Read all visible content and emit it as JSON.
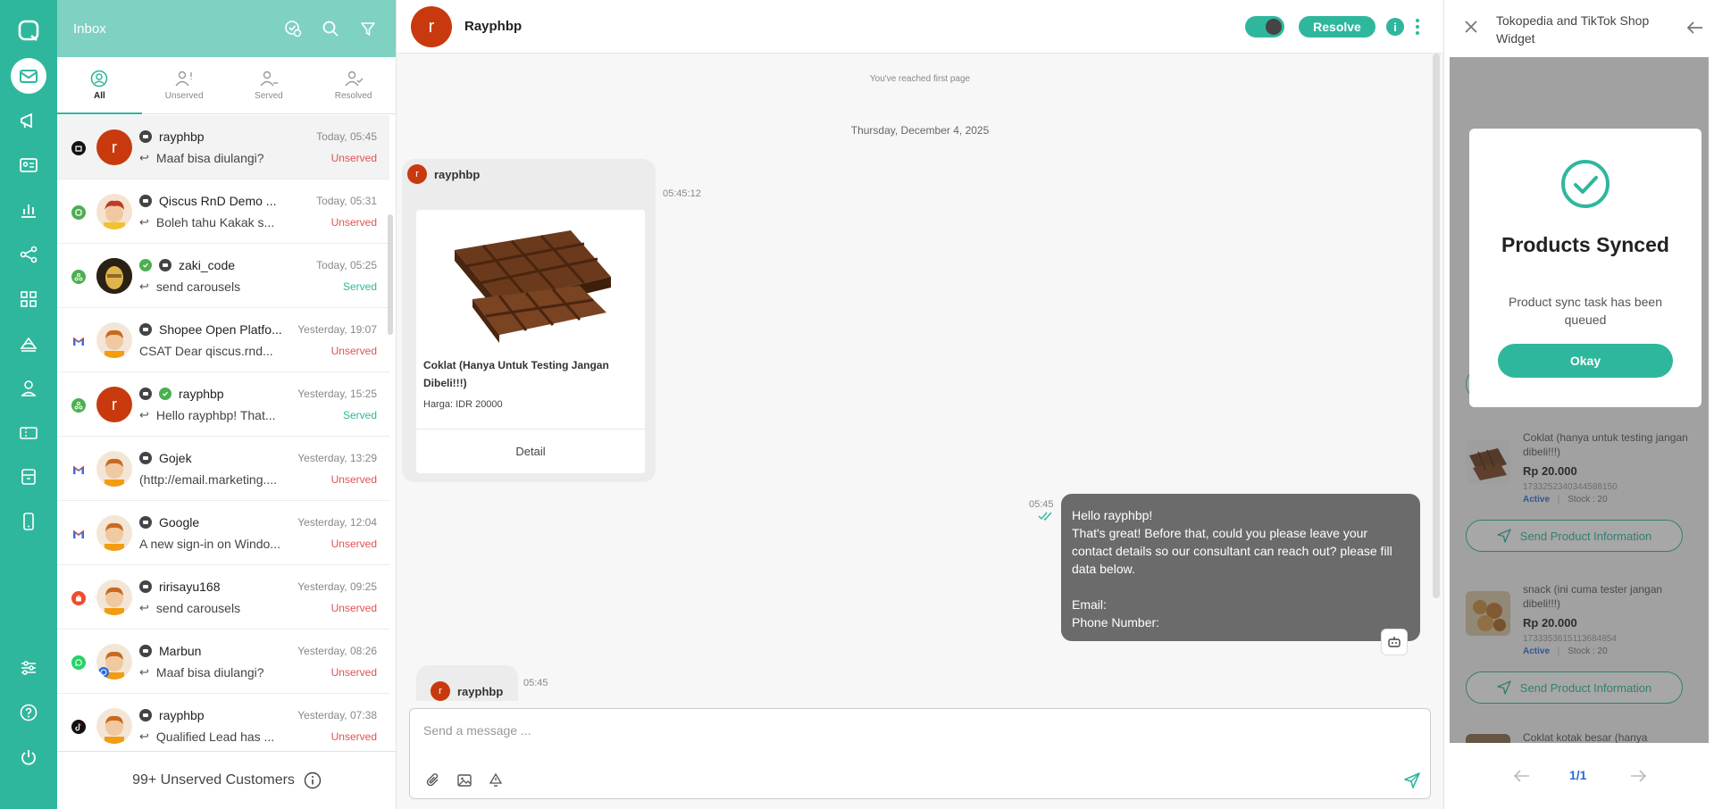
{
  "inbox": {
    "title": "Inbox",
    "tabs": [
      {
        "label": "All"
      },
      {
        "label": "Unserved"
      },
      {
        "label": "Served"
      },
      {
        "label": "Resolved"
      }
    ],
    "conversations": [
      {
        "avatar_letter": "r",
        "name": "rayphbp",
        "time": "Today, 05:45",
        "preview": "Maaf bisa diulangi?",
        "status": "Unserved",
        "channel": "tiktok-icon"
      },
      {
        "avatar_letter": "",
        "name": "Qiscus RnD Demo ...",
        "time": "Today, 05:31",
        "preview": "Boleh tahu Kakak s...",
        "status": "Unserved",
        "channel": "qiscus-icon"
      },
      {
        "avatar_letter": "",
        "name": "zaki_code",
        "time": "Today, 05:25",
        "preview": "send carousels",
        "status": "Served",
        "channel": "webhook-icon"
      },
      {
        "avatar_letter": "",
        "name": "Shopee Open Platfo...",
        "time": "Yesterday, 19:07",
        "preview": "CSAT Dear qiscus.rnd...",
        "status": "Unserved",
        "channel": "gmail-icon"
      },
      {
        "avatar_letter": "r",
        "name": "rayphbp",
        "time": "Yesterday, 15:25",
        "preview": "Hello rayphbp! That...",
        "status": "Served",
        "channel": "webhook-icon"
      },
      {
        "avatar_letter": "",
        "name": "Gojek",
        "time": "Yesterday, 13:29",
        "preview": "(http://email.marketing....",
        "status": "Unserved",
        "channel": "gmail-icon"
      },
      {
        "avatar_letter": "",
        "name": "Google",
        "time": "Yesterday, 12:04",
        "preview": "A new sign-in on Windo...",
        "status": "Unserved",
        "channel": "gmail-icon"
      },
      {
        "avatar_letter": "",
        "name": "ririsayu168",
        "time": "Yesterday, 09:25",
        "preview": "send carousels",
        "status": "Unserved",
        "channel": "shopee-icon"
      },
      {
        "avatar_letter": "",
        "name": "Marbun",
        "time": "Yesterday, 08:26",
        "preview": "Maaf bisa diulangi?",
        "status": "Unserved",
        "channel": "whatsapp-icon"
      },
      {
        "avatar_letter": "",
        "name": "rayphbp",
        "time": "Yesterday, 07:38",
        "preview": "Qualified Lead has ...",
        "status": "Unserved",
        "channel": "tiktok-icon"
      }
    ],
    "footer": "99+ Unserved Customers"
  },
  "chat": {
    "contact_name": "Rayphbp",
    "avatar_letter": "r",
    "resolve_label": "Resolve",
    "first_page_note": "You've reached first page",
    "date_separator": "Thursday, December 4, 2025",
    "incoming": {
      "sender": "rayphbp",
      "time": "05:45:12",
      "product_title": "Coklat (Hanya Untuk Testing Jangan Dibeli!!!)",
      "product_price": "Harga: IDR 20000",
      "detail_label": "Detail"
    },
    "outgoing": {
      "time": "05:45",
      "lines": [
        "Hello rayphbp!",
        "That's great! Before that, could you please leave your contact details so our consultant can reach out? please fill data below.",
        "",
        "Email:",
        "Phone Number:"
      ]
    },
    "incoming2": {
      "sender": "rayphbp",
      "time": "05:45"
    },
    "composer_placeholder": "Send a message ..."
  },
  "panel": {
    "title": "Tokopedia and TikTok Shop Widget",
    "send_label": "Send Product Information",
    "products": [
      {
        "name": "Coklat (hanya untuk testing jangan dibeli!!!)",
        "price": "Rp 20.000",
        "sku": "1733252340344588150",
        "status": "Active",
        "stock": "Stock : 20"
      },
      {
        "name": "snack (ini cuma tester jangan dibeli!!!)",
        "price": "Rp 20.000",
        "sku": "1733353615113684854",
        "status": "Active",
        "stock": "Stock : 20"
      }
    ],
    "partial_product": "Coklat kotak besar (hanya",
    "page_indicator": "1/1",
    "modal": {
      "title": "Products Synced",
      "text": "Product sync task has been queued",
      "button": "Okay"
    }
  },
  "colors": {
    "brand": "#2fb79d",
    "unserved": "#e05252",
    "outgoing_bubble": "#6b6b6b"
  }
}
